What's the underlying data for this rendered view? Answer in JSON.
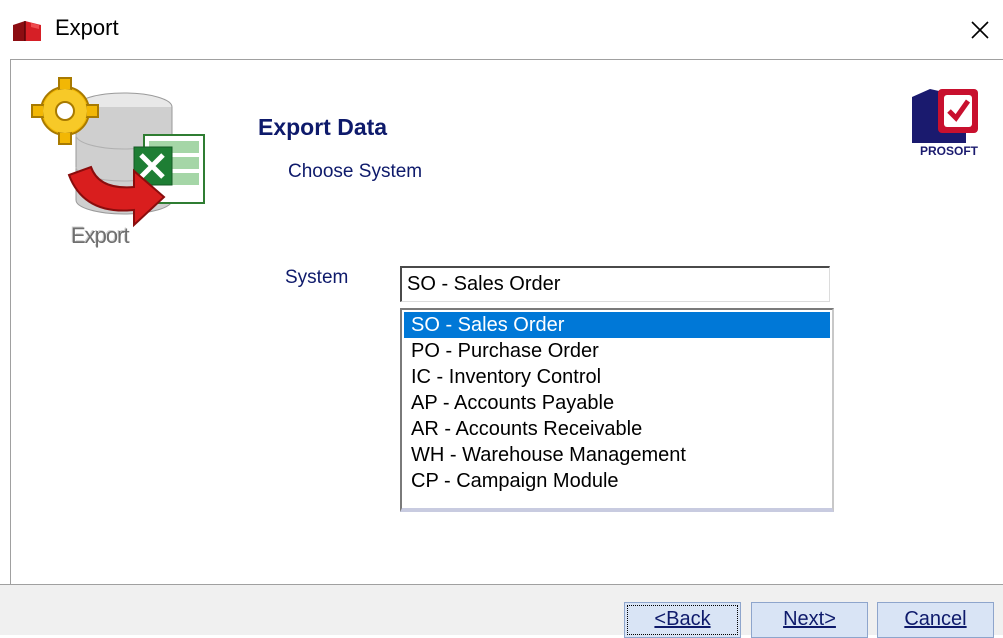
{
  "window": {
    "title": "Export",
    "close_glyph": "✕"
  },
  "header": {
    "heading": "Export Data",
    "subheading": "Choose System",
    "export_caption": "Export",
    "logo_text": "PROSOFT"
  },
  "form": {
    "system_label": "System",
    "system_value": "SO - Sales Order",
    "options": [
      {
        "label": "SO - Sales Order",
        "selected": true
      },
      {
        "label": "PO - Purchase Order",
        "selected": false
      },
      {
        "label": "IC - Inventory Control",
        "selected": false
      },
      {
        "label": "AP - Accounts Payable",
        "selected": false
      },
      {
        "label": "AR - Accounts Receivable",
        "selected": false
      },
      {
        "label": "WH - Warehouse Management",
        "selected": false
      },
      {
        "label": "CP - Campaign Module",
        "selected": false
      }
    ]
  },
  "buttons": {
    "back": "<Back",
    "next": "Next>",
    "cancel": "Cancel"
  },
  "colors": {
    "accent_blue": "#0e1a6b",
    "selection": "#0078d7",
    "button_bg": "#d9e4f5",
    "logo_red": "#c8102e",
    "logo_navy": "#1a1a6e"
  },
  "icons": [
    "app-book-icon",
    "close-icon",
    "export-excel-icon",
    "prosoft-logo"
  ]
}
